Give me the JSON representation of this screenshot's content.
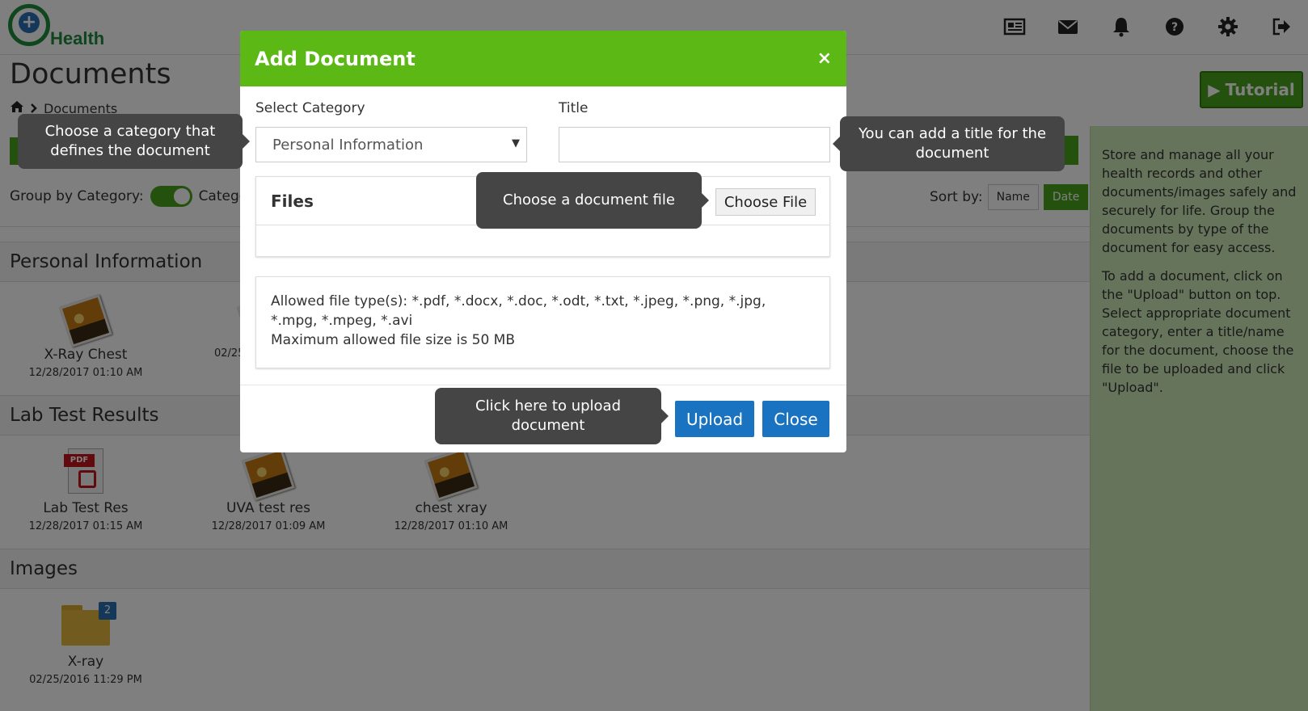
{
  "app": {
    "logo_text": "Health"
  },
  "header_icons": [
    "news-icon",
    "mail-icon",
    "bell-icon",
    "help-icon",
    "gear-icon",
    "logout-icon"
  ],
  "page": {
    "title": "Documents",
    "breadcrumb": "Documents",
    "tutorial_label": "Tutorial"
  },
  "toolbar": {
    "group_label": "Group by Category:",
    "group_toggle_text": "Categor",
    "sort_label": "Sort by:",
    "sort_options": [
      "Name",
      "Date"
    ],
    "sort_active": "Date"
  },
  "sections": [
    {
      "title": "Personal Information",
      "items": [
        {
          "name": "X-Ray Chest",
          "date": "12/28/2017 01:10 AM",
          "icon": "image-icon"
        },
        {
          "name": "",
          "date": "02/25",
          "icon": "image-icon"
        }
      ]
    },
    {
      "title": "Lab Test Results",
      "items": [
        {
          "name": "Lab Test Res",
          "date": "12/28/2017 01:15 AM",
          "icon": "pdf-icon"
        },
        {
          "name": "UVA test res",
          "date": "12/28/2017 01:09 AM",
          "icon": "image-icon"
        },
        {
          "name": "chest xray",
          "date": "12/28/2017 01:10 AM",
          "icon": "image-icon"
        }
      ]
    },
    {
      "title": "Images",
      "items": [
        {
          "name": "X-ray",
          "date": "02/25/2016 11:29 PM",
          "icon": "folder-icon",
          "badge": "2"
        }
      ]
    }
  ],
  "info_panel": {
    "paragraph1": "Store and manage all your health records and other documents/images safely and securely for life. Group the documents by type of the document for easy access.",
    "paragraph2": "To add a document, click on the \"Upload\" button on top. Select appropriate document category, enter a title/name for the document, choose the file to be uploaded and click \"Upload\"."
  },
  "modal": {
    "title": "Add Document",
    "close_symbol": "×",
    "category_label": "Select Category",
    "category_value": "Personal Information",
    "title_label": "Title",
    "title_value": "",
    "files_label": "Files",
    "choose_file_label": "Choose File",
    "allowed_types": "Allowed file type(s): *.pdf, *.docx, *.doc, *.odt, *.txt, *.jpeg, *.png, *.jpg, *.mpg, *.mpeg, *.avi",
    "max_size": "Maximum allowed file size is 50 MB",
    "upload_label": "Upload",
    "close_label": "Close"
  },
  "tooltips": {
    "category": "Choose a category that defines the document",
    "title": "You can add a title for the document",
    "file": "Choose a document file",
    "upload": "Click here to upload document"
  },
  "colors": {
    "brand_green": "#5cb814",
    "button_blue": "#1a73c0",
    "tooltip_bg": "#454545",
    "info_panel_bg": "#cfe9b8"
  }
}
